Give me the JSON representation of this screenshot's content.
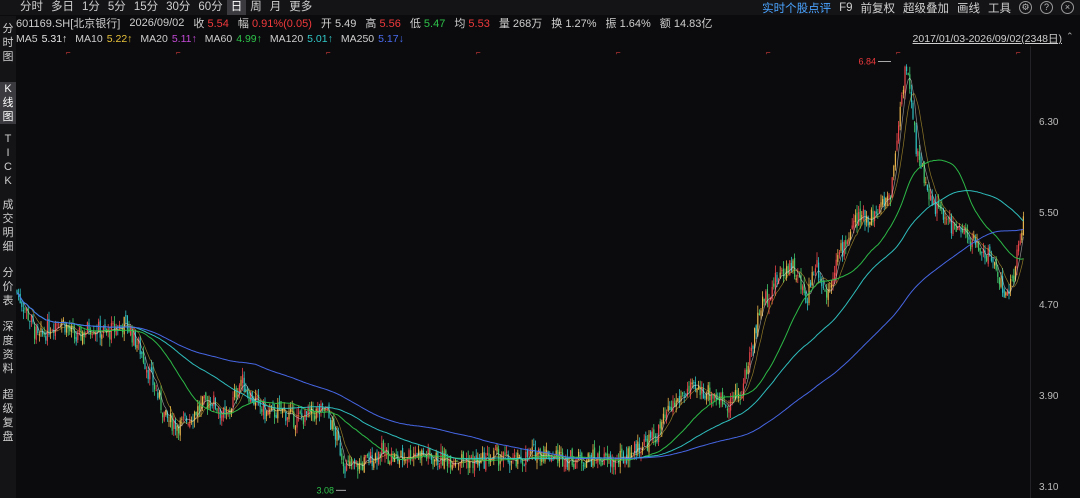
{
  "toolbar": {
    "periods": [
      "分时",
      "多日",
      "1分",
      "5分",
      "15分",
      "30分",
      "60分",
      "日",
      "周",
      "月",
      "更多"
    ],
    "active_period": "日",
    "right_items": [
      "实时个股点评",
      "F9",
      "前复权",
      "超级叠加",
      "画线",
      "工具"
    ],
    "icons": [
      "settings-icon",
      "help-icon",
      "close-icon"
    ]
  },
  "info": {
    "code": "601169.SH[北京银行]",
    "date": "2026/09/02",
    "close_label": "收",
    "close": "5.54",
    "change_label": "幅",
    "change": "0.91%(0.05)",
    "open_label": "开",
    "open": "5.49",
    "high_label": "高",
    "high": "5.56",
    "low_label": "低",
    "low": "5.47",
    "avg_label": "均",
    "avg": "5.53",
    "vol_label": "量",
    "vol": "268万",
    "turnover_label": "换",
    "turnover": "1.27%",
    "amp_label": "振",
    "amp": "1.64%",
    "amount_label": "额",
    "amount": "14.83亿"
  },
  "ma": [
    {
      "label": "MA5",
      "value": "5.31",
      "arrow": "↑",
      "color": "#e8e8e8"
    },
    {
      "label": "MA10",
      "value": "5.22",
      "arrow": "↑",
      "color": "#e8c23a"
    },
    {
      "label": "MA20",
      "value": "5.11",
      "arrow": "↑",
      "color": "#c44ad6"
    },
    {
      "label": "MA60",
      "value": "4.99",
      "arrow": "↑",
      "color": "#2ec24a"
    },
    {
      "label": "MA120",
      "value": "5.01",
      "arrow": "↑",
      "color": "#31c7c7"
    },
    {
      "label": "MA250",
      "value": "5.17",
      "arrow": "↓",
      "color": "#4a6cf0"
    }
  ],
  "range": "2017/01/03-2026/09/02(2348日)",
  "leftnav": [
    {
      "label": "分时图",
      "active": false
    },
    {
      "label": "K线图",
      "active": true
    },
    {
      "label": "TICK",
      "active": false
    },
    {
      "label": "成交明细",
      "active": false
    },
    {
      "label": "分价表",
      "active": false
    },
    {
      "label": "深度资料",
      "active": false
    },
    {
      "label": "超级复盘",
      "active": false
    }
  ],
  "chart_data": {
    "type": "line",
    "series_kind": "candlestick-daily",
    "yticks": [
      "6.30",
      "5.50",
      "4.70",
      "3.90",
      "3.10"
    ],
    "ylim": [
      3.1,
      6.3
    ],
    "max_label": "6.84",
    "min_label": "3.08",
    "price_path": [
      [
        0,
        4.83
      ],
      [
        12,
        4.62
      ],
      [
        22,
        4.4
      ],
      [
        35,
        4.52
      ],
      [
        45,
        4.58
      ],
      [
        60,
        4.4
      ],
      [
        75,
        4.52
      ],
      [
        90,
        4.45
      ],
      [
        110,
        4.55
      ],
      [
        125,
        4.3
      ],
      [
        140,
        3.95
      ],
      [
        150,
        3.7
      ],
      [
        165,
        3.65
      ],
      [
        180,
        3.78
      ],
      [
        195,
        3.88
      ],
      [
        210,
        3.7
      ],
      [
        225,
        4.05
      ],
      [
        235,
        3.9
      ],
      [
        250,
        3.75
      ],
      [
        265,
        3.78
      ],
      [
        280,
        3.7
      ],
      [
        295,
        3.75
      ],
      [
        310,
        3.78
      ],
      [
        320,
        3.55
      ],
      [
        330,
        3.28
      ],
      [
        345,
        3.3
      ],
      [
        365,
        3.42
      ],
      [
        380,
        3.35
      ],
      [
        400,
        3.42
      ],
      [
        420,
        3.35
      ],
      [
        440,
        3.36
      ],
      [
        460,
        3.32
      ],
      [
        480,
        3.38
      ],
      [
        500,
        3.32
      ],
      [
        520,
        3.42
      ],
      [
        540,
        3.38
      ],
      [
        560,
        3.35
      ],
      [
        580,
        3.36
      ],
      [
        600,
        3.32
      ],
      [
        620,
        3.45
      ],
      [
        640,
        3.55
      ],
      [
        655,
        3.8
      ],
      [
        670,
        3.95
      ],
      [
        690,
        3.95
      ],
      [
        710,
        3.85
      ],
      [
        725,
        3.92
      ],
      [
        745,
        4.7
      ],
      [
        760,
        4.92
      ],
      [
        775,
        5.08
      ],
      [
        790,
        4.75
      ],
      [
        800,
        5.1
      ],
      [
        810,
        4.78
      ],
      [
        820,
        5.08
      ],
      [
        840,
        5.45
      ],
      [
        860,
        5.5
      ],
      [
        875,
        5.7
      ],
      [
        885,
        6.5
      ],
      [
        890,
        6.84
      ],
      [
        900,
        6.1
      ],
      [
        915,
        5.62
      ],
      [
        930,
        5.45
      ],
      [
        950,
        5.3
      ],
      [
        965,
        5.2
      ],
      [
        980,
        5.05
      ],
      [
        990,
        4.75
      ],
      [
        1000,
        5.05
      ],
      [
        1008,
        5.54
      ]
    ]
  }
}
